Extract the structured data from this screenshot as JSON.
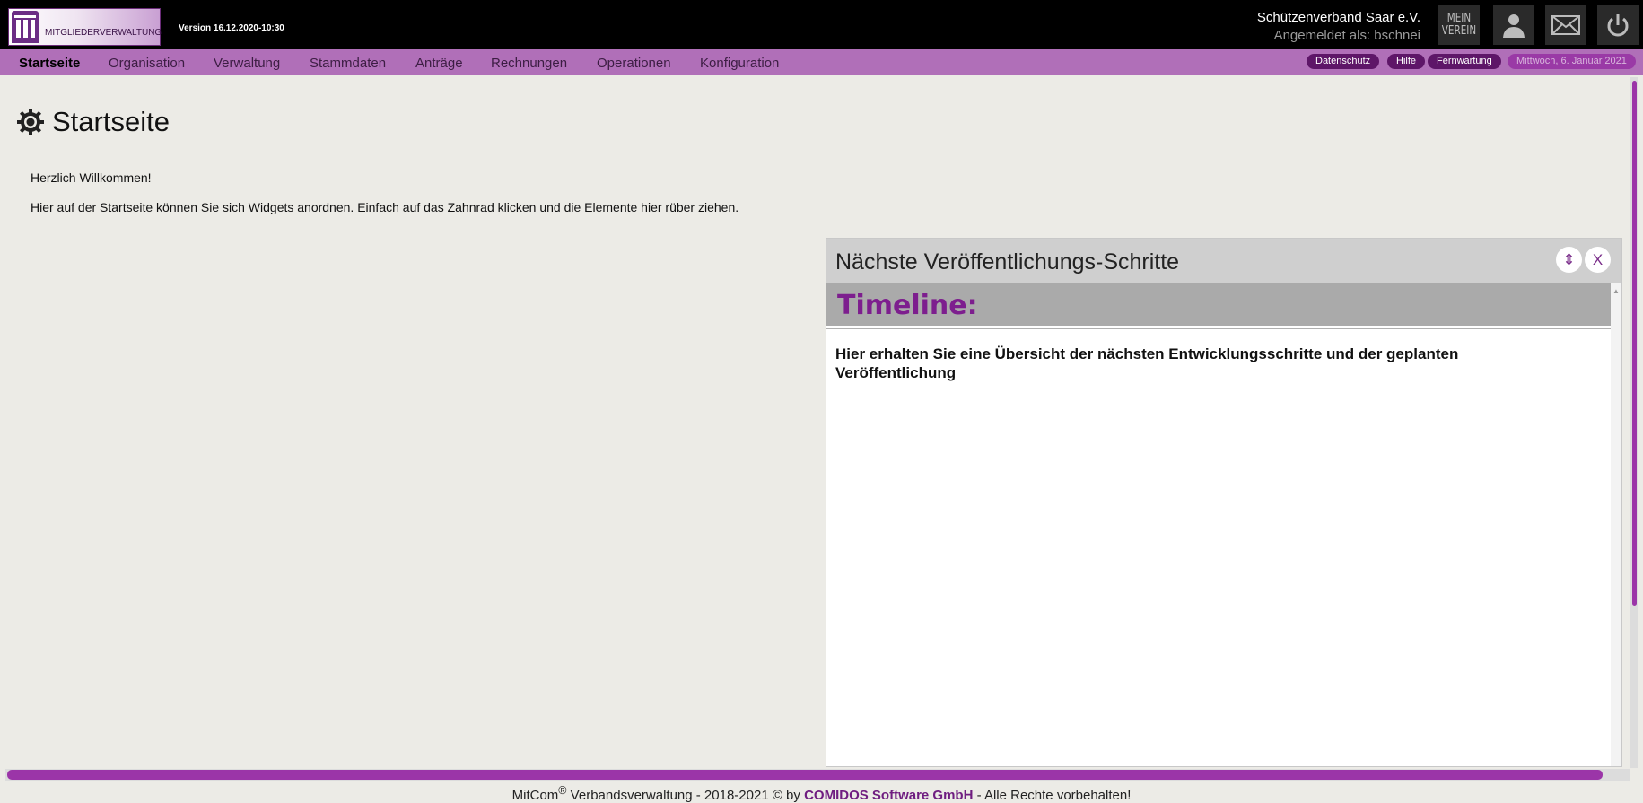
{
  "header": {
    "logo_text": "MITGLIEDERVERWALTUNG",
    "version": "Version 16.12.2020-10:30",
    "org_name": "Schützenverband Saar e.V.",
    "logged_in": "Angemeldet als: bschnei",
    "mein_verein": "MEIN VEREIN",
    "icons": [
      "user-icon",
      "mail-icon",
      "power-icon"
    ]
  },
  "nav": {
    "items": [
      "Startseite",
      "Organisation",
      "Verwaltung",
      "Stammdaten",
      "Anträge",
      "Rechnungen",
      "Operationen",
      "Konfiguration"
    ],
    "active": "Startseite",
    "pills": [
      "Datenschutz",
      "Hilfe",
      "Fernwartung"
    ],
    "date": "Mittwoch, 6. Januar 2021"
  },
  "main": {
    "title": "Startseite",
    "welcome": "Herzlich Willkommen!",
    "hint": "Hier auf der Startseite können Sie sich Widgets anordnen. Einfach auf das Zahnrad klicken und die Elemente hier rüber ziehen."
  },
  "widget": {
    "title": "Nächste Veröffentlichungs-Schritte",
    "move_label": "⇕",
    "close_label": "X",
    "timeline_label": "Timeline:",
    "text": "Hier erhalten Sie eine Übersicht der nächsten Entwicklungsschritte und der geplanten Veröffentlichung"
  },
  "footer": {
    "prefix": "MitCom",
    "reg": "®",
    "middle": " Verbandsverwaltung -  2018-2021 © by ",
    "company": "COMIDOS Software GmbH",
    "suffix": " - Alle Rechte vorbehalten!"
  },
  "colors": {
    "accent": "#b06fb8",
    "brand_dark": "#5e1668",
    "timeline_text": "#7d1e8e"
  }
}
